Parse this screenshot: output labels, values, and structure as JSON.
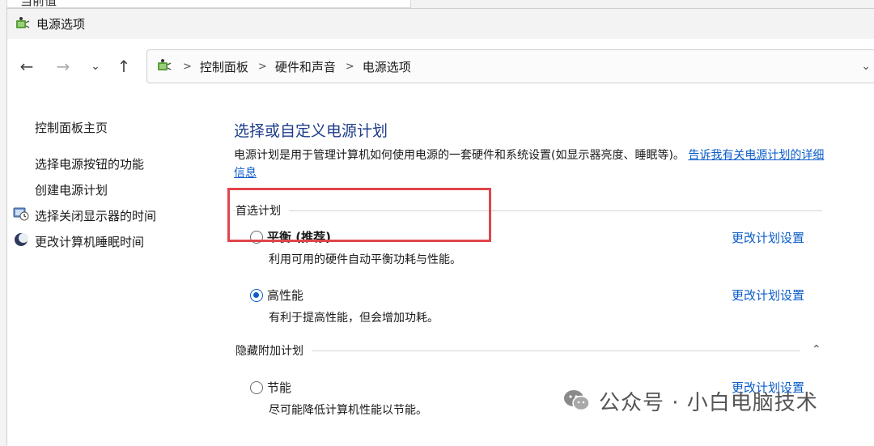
{
  "behind_window": {
    "text": "当前值"
  },
  "titlebar": {
    "title": "电源选项",
    "icon": "power-options-icon"
  },
  "nav": {
    "back": "←",
    "forward": "→",
    "recent": "⌄",
    "up": "↑"
  },
  "address": {
    "separator": ">",
    "crumbs": [
      "控制面板",
      "硬件和声音",
      "电源选项"
    ],
    "dropdown": "⌄"
  },
  "sidebar": {
    "home": "控制面板主页",
    "items": [
      {
        "label": "选择电源按钮的功能",
        "icon": ""
      },
      {
        "label": "创建电源计划",
        "icon": ""
      },
      {
        "label": "选择关闭显示器的时间",
        "icon": "display-icon"
      },
      {
        "label": "更改计算机睡眠时间",
        "icon": "sleep-moon-icon"
      }
    ]
  },
  "main": {
    "heading": "选择或自定义电源计划",
    "description": "电源计划是用于管理计算机如何使用电源的一套硬件和系统设置(如显示器亮度、睡眠等)。",
    "description_link": "告诉我有关电源计划的详细信息",
    "preferred_group": "首选计划",
    "hidden_group": "隐藏附加计划",
    "collapse_icon": "⌃",
    "plans": [
      {
        "name": "平衡 (推荐)",
        "desc": "利用可用的硬件自动平衡功耗与性能。",
        "link": "更改计划设置",
        "selected": false
      },
      {
        "name": "高性能",
        "desc": "有利于提高性能，但会增加功耗。",
        "link": "更改计划设置",
        "selected": true
      },
      {
        "name": "节能",
        "desc": "尽可能降低计算机性能以节能。",
        "link": "更改计划设置",
        "selected": false
      }
    ]
  },
  "watermark": {
    "text": "公众号 · 小白电脑技术"
  },
  "colors": {
    "accent": "#0f5cd1",
    "heading": "#1f3d8a",
    "link": "#0b5cc9",
    "highlight_box": "#e0454b"
  }
}
